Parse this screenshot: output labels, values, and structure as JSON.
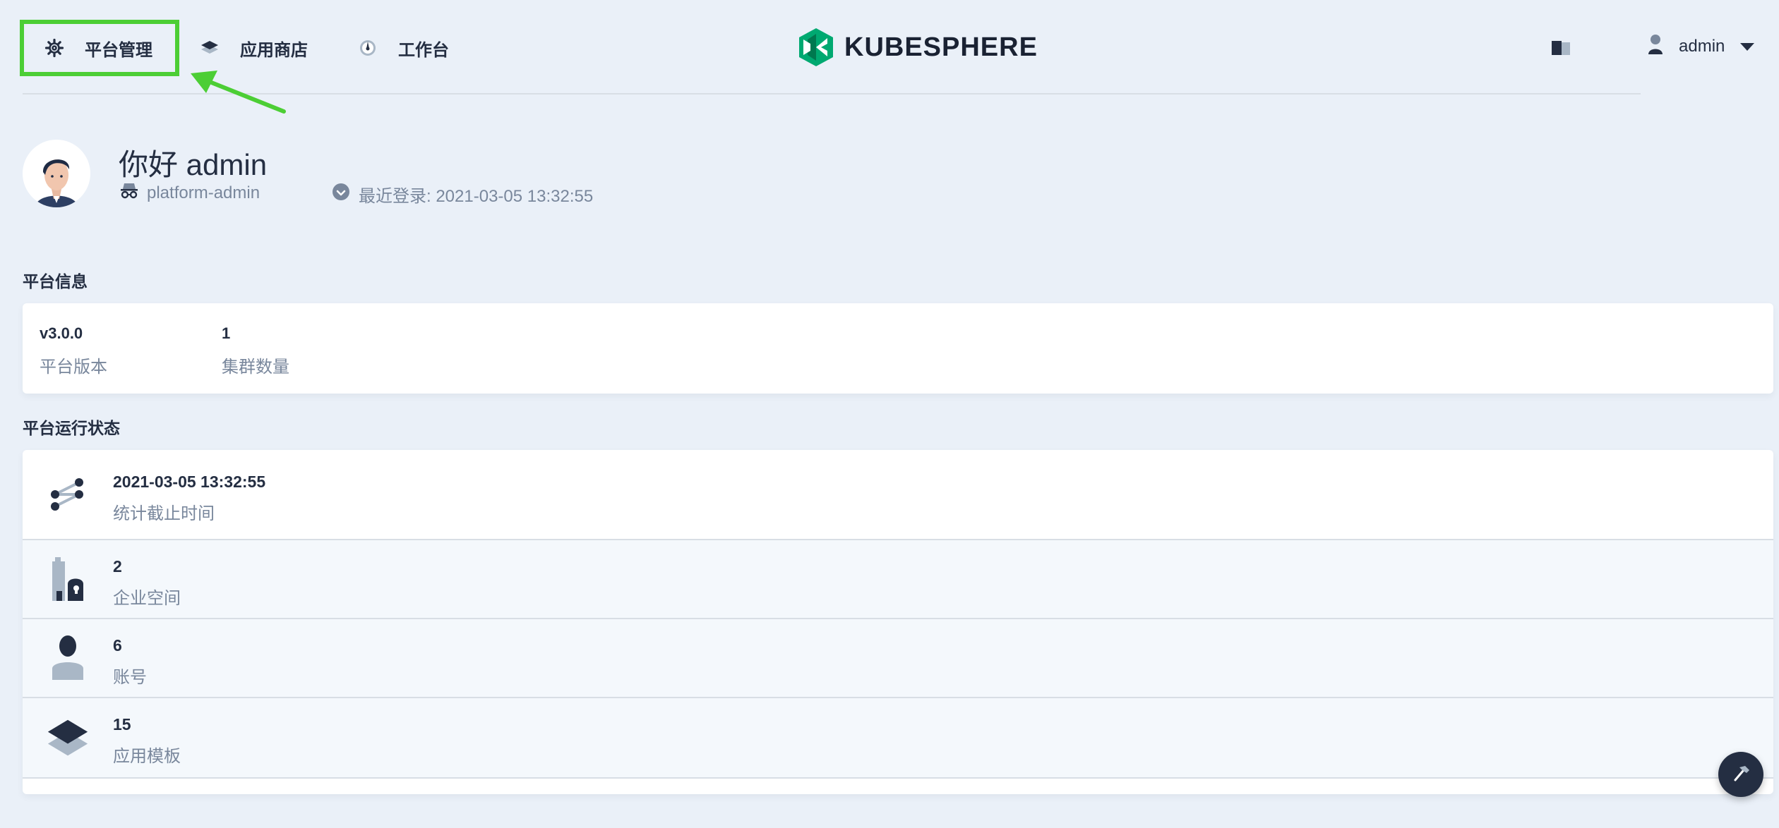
{
  "nav": {
    "items": [
      {
        "label": "平台管理",
        "icon": "gear-icon"
      },
      {
        "label": "应用商店",
        "icon": "layers-icon"
      },
      {
        "label": "工作台",
        "icon": "dashboard-icon"
      }
    ],
    "logo_text": "KUBESPHERE",
    "user": {
      "name": "admin"
    }
  },
  "header": {
    "greeting": "你好 admin",
    "role": "platform-admin",
    "last_login": "最近登录: 2021-03-05 13:32:55"
  },
  "platform_info": {
    "title": "平台信息",
    "items": [
      {
        "value": "v3.0.0",
        "label": "平台版本"
      },
      {
        "value": "1",
        "label": "集群数量"
      }
    ]
  },
  "platform_status": {
    "title": "平台运行状态",
    "rows": [
      {
        "value": "2021-03-05 13:32:55",
        "label": "统计截止时间",
        "icon": "share-nodes-icon"
      },
      {
        "value": "2",
        "label": "企业空间",
        "icon": "workspace-icon"
      },
      {
        "value": "6",
        "label": "账号",
        "icon": "user-icon"
      },
      {
        "value": "15",
        "label": "应用模板",
        "icon": "app-template-icon"
      }
    ]
  },
  "colors": {
    "accent_highlight": "#4cce35",
    "primary_text": "#242e42",
    "secondary_text": "#79879c",
    "background": "#eaf0f8",
    "logo_green": "#00a971"
  }
}
